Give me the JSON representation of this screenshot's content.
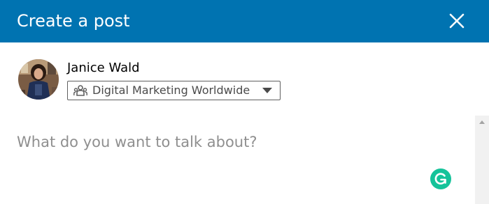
{
  "dialog": {
    "title": "Create a post",
    "close_icon": "close-icon"
  },
  "author": {
    "name": "Janice Wald",
    "avatar_icon": "avatar-photo"
  },
  "audience": {
    "label": "Digital Marketing Worldwide",
    "icon": "group-icon",
    "caret_icon": "caret-down-icon"
  },
  "editor": {
    "placeholder": "What do you want to talk about?"
  },
  "grammarly": {
    "icon": "grammarly-icon"
  },
  "colors": {
    "header_bg": "#0073b1",
    "header_text": "#ffffff",
    "placeholder_text": "#8f8f8f",
    "grammarly_green": "#15c39a",
    "select_border": "#5f5f5f"
  }
}
